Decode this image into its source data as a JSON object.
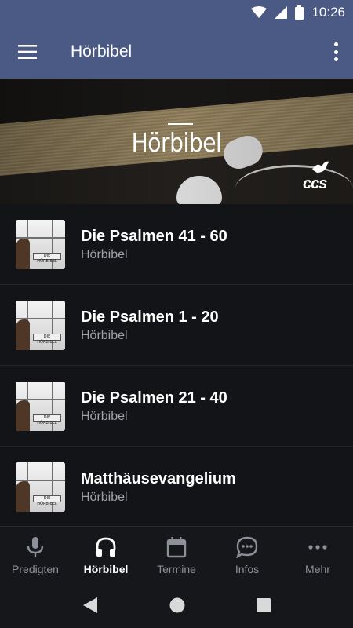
{
  "status_bar": {
    "time": "10:26"
  },
  "app_bar": {
    "title": "Hörbibel"
  },
  "hero": {
    "heading": "Hörbibel",
    "logo_text": "ccs"
  },
  "list": {
    "items": [
      {
        "title": "Die Psalmen 41 - 60",
        "subtitle": "Hörbibel",
        "thumb_label": "DIE HÖRBIBEL"
      },
      {
        "title": "Die Psalmen 1 - 20",
        "subtitle": "Hörbibel",
        "thumb_label": "DIE HÖRBIBEL"
      },
      {
        "title": "Die Psalmen 21 - 40",
        "subtitle": "Hörbibel",
        "thumb_label": "DIE HÖRBIBEL"
      },
      {
        "title": "Matthäusevangelium",
        "subtitle": "Hörbibel",
        "thumb_label": "DIE HÖRBIBEL"
      }
    ]
  },
  "tabs": [
    {
      "label": "Predigten",
      "icon": "microphone-icon",
      "active": false
    },
    {
      "label": "Hörbibel",
      "icon": "headphones-icon",
      "active": true
    },
    {
      "label": "Termine",
      "icon": "calendar-icon",
      "active": false
    },
    {
      "label": "Infos",
      "icon": "chat-bubble-icon",
      "active": false
    },
    {
      "label": "Mehr",
      "icon": "more-horizontal-icon",
      "active": false
    }
  ],
  "colors": {
    "app_bar": "#4a5a84",
    "background": "#121316",
    "tab_active": "#ffffff",
    "tab_inactive": "#8d9098"
  }
}
